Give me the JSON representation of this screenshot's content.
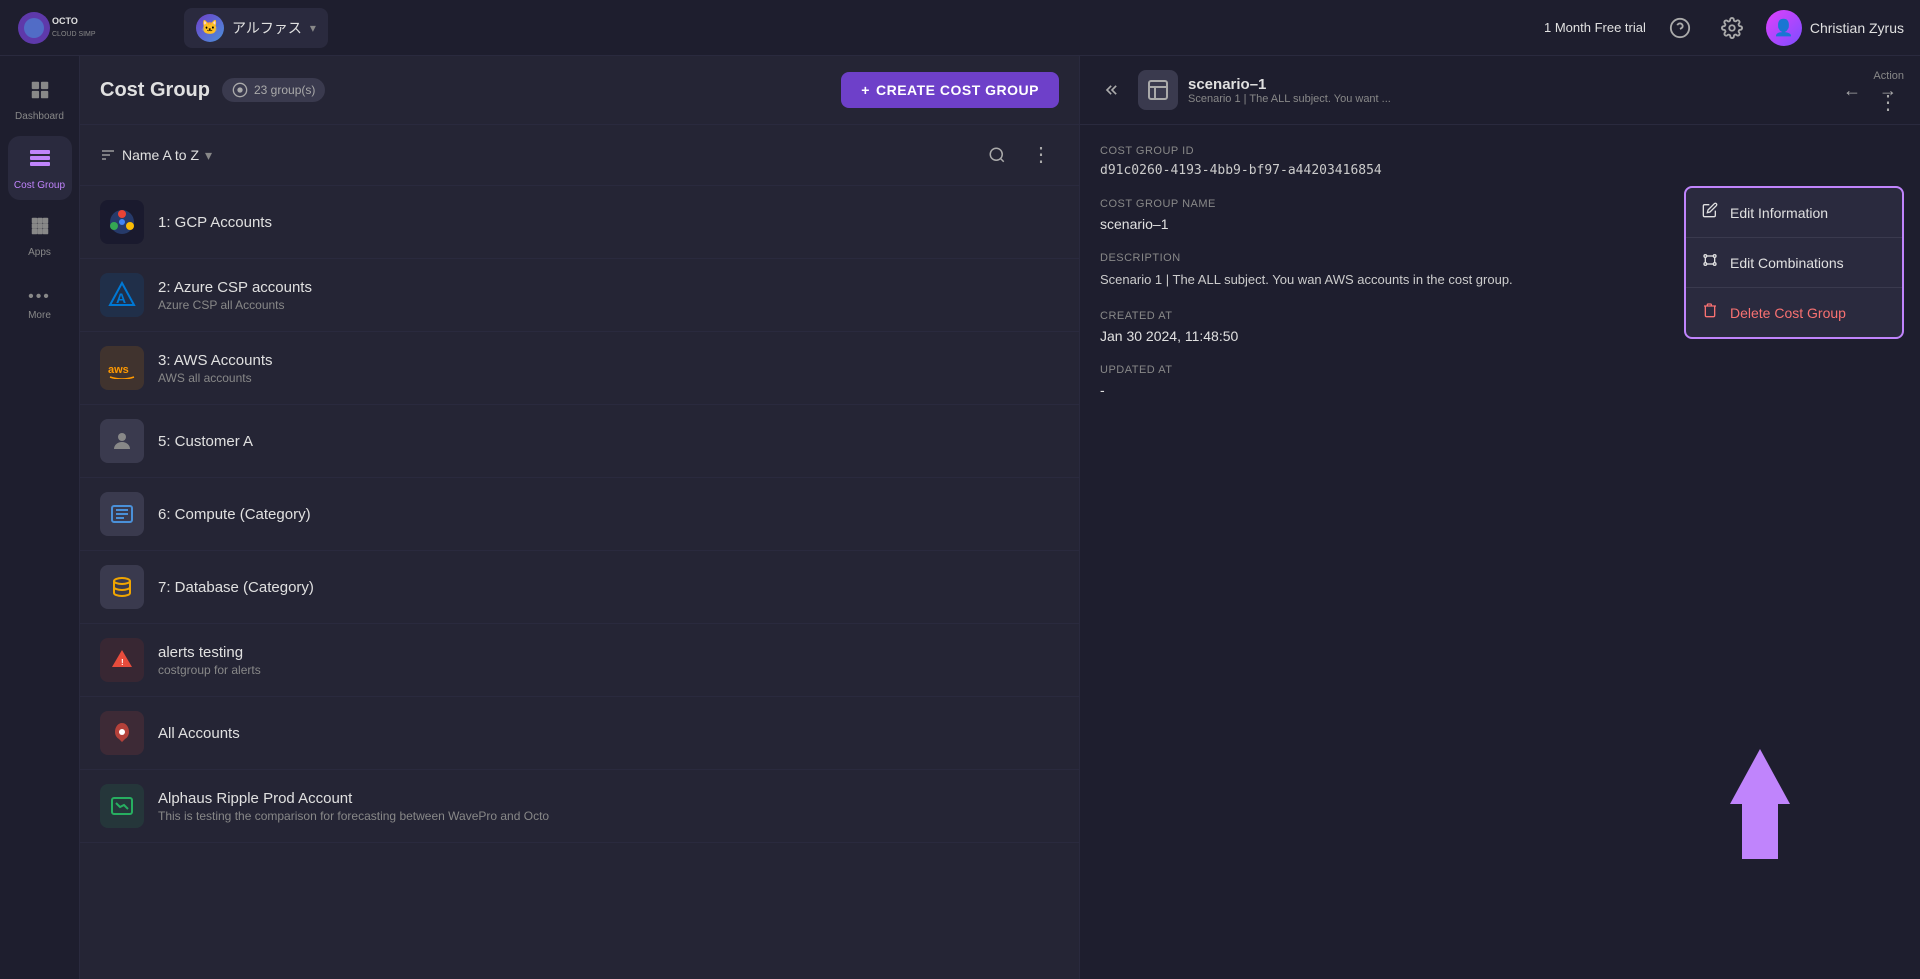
{
  "topNav": {
    "logoAlt": "Octo Cloud Simplified",
    "workspace": {
      "name": "アルファス",
      "avatarEmoji": "🐱"
    },
    "trial": "1 Month Free trial",
    "userGreeting": "Christian Zyrus"
  },
  "sidebar": {
    "items": [
      {
        "id": "dashboard",
        "label": "Dashboard",
        "icon": "⊞",
        "active": false
      },
      {
        "id": "cost-group",
        "label": "Cost Group",
        "icon": "◈",
        "active": true
      },
      {
        "id": "apps",
        "label": "Apps",
        "icon": "⠿",
        "active": false
      },
      {
        "id": "more",
        "label": "More",
        "icon": "•••",
        "active": false
      }
    ]
  },
  "centerPanel": {
    "title": "Cost Group",
    "groupCount": "23 group(s)",
    "groupCountIcon": "◉",
    "createButton": "CREATE COST GROUP",
    "sortLabel": "Name A to Z",
    "items": [
      {
        "id": 1,
        "name": "1: GCP Accounts",
        "sub": "",
        "iconBg": "#1a73e8",
        "iconEmoji": "🔵",
        "iconType": "gcp"
      },
      {
        "id": 2,
        "name": "2: Azure CSP accounts",
        "sub": "Azure CSP all Accounts",
        "iconBg": "#0078d4",
        "iconEmoji": "🔷",
        "iconType": "azure"
      },
      {
        "id": 3,
        "name": "3: AWS Accounts",
        "sub": "AWS all accounts",
        "iconBg": "#ff9900",
        "iconEmoji": "☁",
        "iconType": "aws"
      },
      {
        "id": 5,
        "name": "5: Customer A",
        "sub": "",
        "iconBg": "#3a3a4e",
        "iconEmoji": "👤",
        "iconType": "user"
      },
      {
        "id": 6,
        "name": "6: Compute (Category)",
        "sub": "",
        "iconBg": "#3a3a4e",
        "iconEmoji": "📋",
        "iconType": "compute"
      },
      {
        "id": 7,
        "name": "7: Database (Category)",
        "sub": "",
        "iconBg": "#3a3a4e",
        "iconEmoji": "🗄",
        "iconType": "database"
      },
      {
        "id": 8,
        "name": "alerts testing",
        "sub": "costgroup for alerts",
        "iconBg": "#c0392b",
        "iconEmoji": "📢",
        "iconType": "alert"
      },
      {
        "id": 9,
        "name": "All Accounts",
        "sub": "",
        "iconBg": "#e74c3c",
        "iconEmoji": "☁",
        "iconType": "cloud"
      },
      {
        "id": 10,
        "name": "Alphaus Ripple Prod Account",
        "sub": "This is testing the comparison for forecasting between WavePro and Octo",
        "iconBg": "#27ae60",
        "iconEmoji": "💻",
        "iconType": "laptop"
      }
    ]
  },
  "rightPanel": {
    "scenarioName": "scenario–1",
    "scenarioDesc": "Scenario 1 | The ALL subject. You want ...",
    "actionLabel": "Action",
    "details": {
      "costGroupIdLabel": "Cost Group ID",
      "costGroupIdValue": "d91c0260-4193-4bb9-bf97-a44203416854",
      "costGroupNameLabel": "Cost Group Name",
      "costGroupNameValue": "scenario–1",
      "descriptionLabel": "Description",
      "descriptionValue": "Scenario 1 | The ALL subject. You wan AWS accounts in the cost group.",
      "createdAtLabel": "Created At",
      "createdAtValue": "Jan 30 2024, 11:48:50",
      "updatedAtLabel": "Updated At",
      "updatedAtValue": "-"
    },
    "dropdownMenu": {
      "items": [
        {
          "id": "edit-info",
          "label": "Edit Information",
          "icon": "✏",
          "danger": false
        },
        {
          "id": "edit-combinations",
          "label": "Edit Combinations",
          "icon": "⚙",
          "danger": false
        },
        {
          "id": "delete-cost-group",
          "label": "Delete Cost Group",
          "icon": "🗑",
          "danger": true
        }
      ]
    }
  }
}
